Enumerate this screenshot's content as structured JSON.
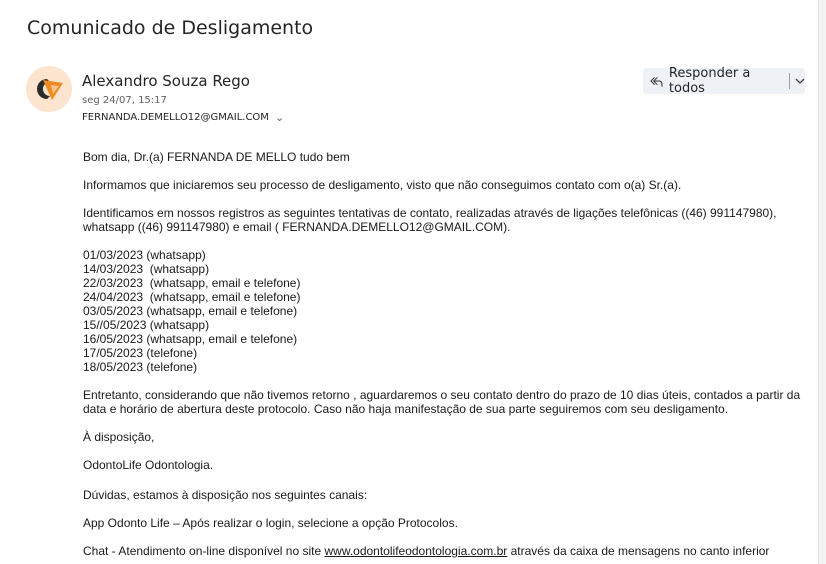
{
  "email": {
    "subject": "Comunicado de Desligamento",
    "sender": "Alexandro Souza Rego",
    "datetime": "seg 24/07, 15:17",
    "recipient": "FERNANDA.DEMELLO12@GMAIL.COM",
    "reply_all_label": "Responder a todos",
    "avatar_color": "#fde4cf",
    "accent_color": "#f08a24"
  },
  "body": {
    "greeting": "Bom dia, Dr.(a) FERNANDA DE MELLO tudo bem",
    "p1": "Informamos que iniciaremos seu processo de desligamento, visto que não conseguimos contato com o(a) Sr.(a).",
    "p2": "Identificamos em nossos registros as seguintes tentativas de contato, realizadas através de ligações telefônicas ((46) 991147980), whatsapp ((46) 991147980) e email ( FERNANDA.DEMELLO12@GMAIL.COM).",
    "attempts": [
      "01/03/2023 (whatsapp)",
      "14/03/2023  (whatsapp)",
      "22/03/2023  (whatsapp, email e telefone)",
      "24/04/2023  (whatsapp, email e telefone)",
      "03/05/2023 (whatsapp, email e telefone)",
      "15//05/2023 (whatsapp)",
      "16/05/2023 (whatsapp, email e telefone)",
      "17/05/2023 (telefone)",
      "18/05/2023 (telefone)"
    ],
    "p3": "Entretanto, considerando que não tivemos retorno , aguardaremos o seu contato dentro do prazo de 10 dias úteis, contados a partir da data e horário de abertura deste protocolo. Caso não haja manifestação de sua parte seguiremos com seu desligamento.",
    "closing": "À disposição,",
    "signature": "OdontoLife Odontologia.",
    "doubts": "Dúvidas, estamos à disposição nos seguintes canais:",
    "app": "App Odonto Life – Após realizar o login, selecione a opção Protocolos.",
    "chat_prefix": "Chat - Atendimento on-line disponível no site ",
    "chat_link": "www.odontolifeodontologia.com.br",
    "chat_suffix": " através da caixa de mensagens no canto inferior"
  }
}
